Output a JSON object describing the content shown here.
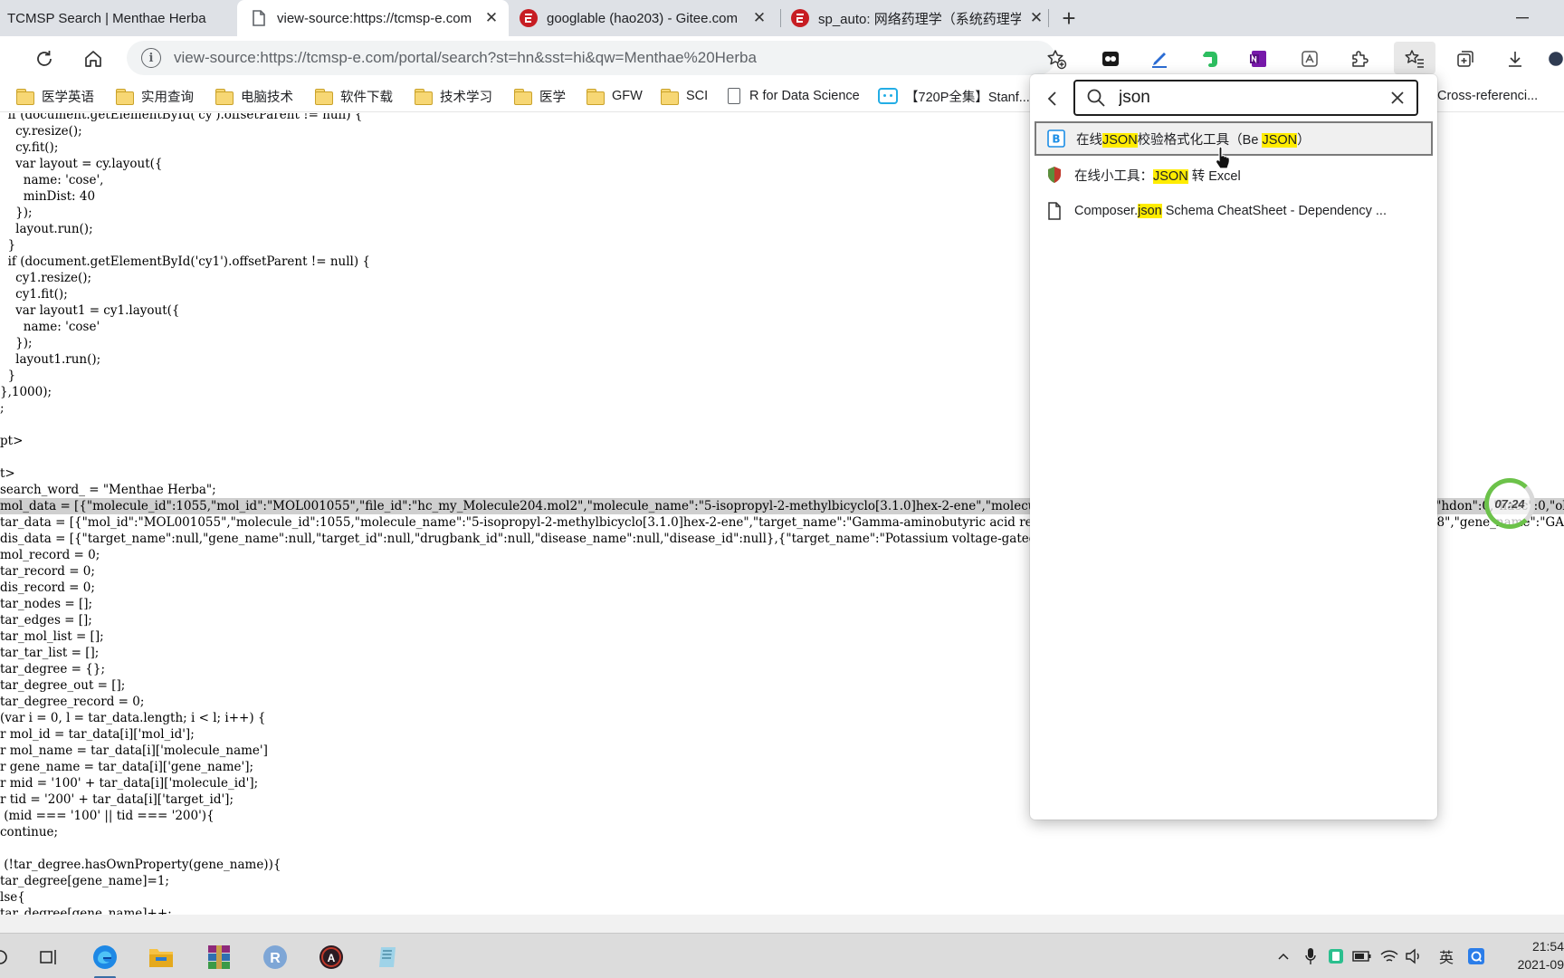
{
  "tabs": [
    {
      "title": "TCMSP Search | Menthae Herba",
      "icon": "page-icon"
    },
    {
      "title": "view-source:https://tcmsp-e.com",
      "icon": "document-icon",
      "active": true
    },
    {
      "title": "googlable (hao203) - Gitee.com",
      "icon": "gitee-icon"
    },
    {
      "title": "sp_auto: 网络药理学（系统药理学",
      "icon": "gitee-icon"
    }
  ],
  "address": {
    "url": "view-source:https://tcmsp-e.com/portal/search?st=hn&sst=hi&qw=Menthae%20Herba"
  },
  "bookmarks": [
    {
      "label": "医学英语",
      "icon": "folder-icon"
    },
    {
      "label": "实用查询",
      "icon": "folder-icon"
    },
    {
      "label": "电脑技术",
      "icon": "folder-icon"
    },
    {
      "label": "软件下载",
      "icon": "folder-icon"
    },
    {
      "label": "技术学习",
      "icon": "folder-icon"
    },
    {
      "label": "医学",
      "icon": "folder-icon"
    },
    {
      "label": "GFW",
      "icon": "folder-icon"
    },
    {
      "label": "SCI",
      "icon": "folder-icon"
    },
    {
      "label": "R for Data Science",
      "icon": "page-icon"
    },
    {
      "label": "【720P全集】Stanf...",
      "icon": "bilibili-icon"
    },
    {
      "label": "Cross-referenci...",
      "icon": "page-icon"
    }
  ],
  "source_lines": [
    "  if (document.getElementById('cy').offsetParent != null) {",
    "    cy.resize();",
    "    cy.fit();",
    "    var layout = cy.layout({",
    "      name: 'cose',",
    "      minDist: 40",
    "    });",
    "    layout.run();",
    "  }",
    "  if (document.getElementById('cy1').offsetParent != null) {",
    "    cy1.resize();",
    "    cy1.fit();",
    "    var layout1 = cy1.layout({",
    "      name: 'cose'",
    "    });",
    "    layout1.run();",
    "  }",
    "},1000);",
    ";",
    "",
    "pt>",
    "",
    "t>",
    "search_word_ = \"Menthae Herba\";",
    "mol_data = [{\"molecule_id\":1055,\"mol_id\":\"MOL001055\",\"file_id\":\"hc_my_Molecule204.mol2\",\"molecule_name\":\"5-isopropyl-2-methylbicyclo[3.1.0]hex-2-ene\",\"molecule_smiles\":\"CC1=CCC2(C1C2)C(C)C\",\"mw\":136.26,\"alogp\":3.36,\"hdon\":0,\"hacc\":0,\"ob\":34.04,\"caco2\":1.73,\"bbb\":2.15,\"dl\":0.03\",\"caco2\":1.8155",
    "tar_data = [{\"mol_id\":\"MOL001055\",\"molecule_id\":1055,\"molecule_name\":\"5-isopropyl-2-methylbicyclo[3.1.0]hex-2-ene\",\"target_name\":\"Gamma-aminobutyric acid receptor subunit alpha-1\",\"target_id\":2372,\"drugbank_id\":\"DB01118\",\"gene_name\":\"GABRA1\",\"drugbank_  872\",\"",
    "dis_data = [{\"target_name\":null,\"gene_name\":null,\"target_id\":null,\"drugbank_id\":null,\"disease_name\":null,\"disease_id\":null},{\"target_name\":\"Potassium voltage-gated channel subfamily H member 2\",\"gene_name\":\"KCNH2\",\"ta",
    "mol_record = 0;",
    "tar_record = 0;",
    "dis_record = 0;",
    "tar_nodes = [];",
    "tar_edges = [];",
    "tar_mol_list = [];",
    "tar_tar_list = [];",
    "tar_degree = {};",
    "tar_degree_out = [];",
    "tar_degree_record = 0;",
    "(var i = 0, l = tar_data.length; i < l; i++) {",
    "r mol_id = tar_data[i]['mol_id'];",
    "r mol_name = tar_data[i]['molecule_name']",
    "r gene_name = tar_data[i]['gene_name'];",
    "r mid = '100' + tar_data[i]['molecule_id'];",
    "r tid = '200' + tar_data[i]['target_id'];",
    " (mid === '100' || tid === '200'){",
    "continue;",
    "",
    " (!tar_degree.hasOwnProperty(gene_name)){",
    "tar_degree[gene_name]=1;",
    "lse{",
    "tar_degree[gene_name]++;"
  ],
  "favorites_search": {
    "query": "json",
    "results": [
      {
        "pre": "在线",
        "match": "JSON",
        "mid": "校验格式化工具（Be ",
        "match2": "JSON",
        "post": "）",
        "icon": "bejson-icon"
      },
      {
        "pre": "在线小工具：",
        "match": "JSON",
        "mid": " 转 Excel",
        "match2": "",
        "post": "",
        "icon": "shield-icon"
      },
      {
        "pre": "Composer.",
        "match": "json",
        "mid": " Schema CheatSheet - Dependency ...",
        "match2": "",
        "post": "",
        "icon": "page-icon"
      }
    ]
  },
  "overlay": {
    "timer": "07:24"
  },
  "taskbar": {
    "ime_label": "英",
    "time": "21:54",
    "date": "2021-09"
  },
  "colors": {
    "highlight": "#ffec00",
    "selection": "#cfcfcf",
    "edge_blue": "#0c59a4"
  }
}
